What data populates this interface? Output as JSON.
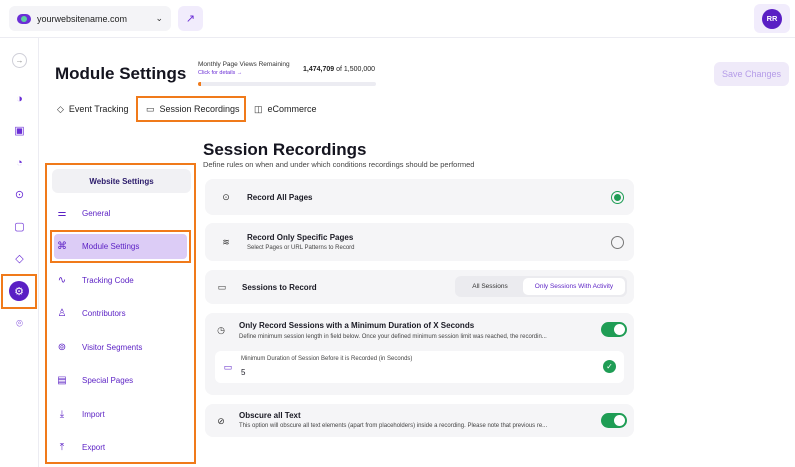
{
  "topbar": {
    "site": "yourwebsitename.com",
    "avatar_initials": "RR"
  },
  "header": {
    "title": "Module Settings",
    "pageviews_label": "Monthly Page Views Remaining",
    "pageviews_link": "Click for details →",
    "pageviews_used": "1,474,709",
    "pageviews_of": "of 1,500,000",
    "pageviews_fraction": 0.017,
    "save_label": "Save Changes"
  },
  "tabs": [
    {
      "label": "Event Tracking",
      "icon": "tag-icon"
    },
    {
      "label": "Session Recordings",
      "icon": "camera-icon"
    },
    {
      "label": "eCommerce",
      "icon": "bag-icon"
    }
  ],
  "sidebar": {
    "heading": "Website Settings",
    "items": [
      {
        "label": "General",
        "icon": "sliders-icon"
      },
      {
        "label": "Module Settings",
        "icon": "command-icon"
      },
      {
        "label": "Tracking Code",
        "icon": "pulse-icon"
      },
      {
        "label": "Contributors",
        "icon": "user-icon"
      },
      {
        "label": "Visitor Segments",
        "icon": "segments-icon"
      },
      {
        "label": "Special Pages",
        "icon": "pages-icon"
      },
      {
        "label": "Import",
        "icon": "import-icon"
      },
      {
        "label": "Export",
        "icon": "export-icon"
      }
    ]
  },
  "section": {
    "title": "Session Recordings",
    "subtitle": "Define rules on when and under which conditions recordings should be performed"
  },
  "options": {
    "record_all": {
      "title": "Record All Pages",
      "selected": true
    },
    "record_specific": {
      "title": "Record Only Specific Pages",
      "desc": "Select Pages or URL Patterns to Record",
      "selected": false
    },
    "sessions": {
      "title": "Sessions to Record",
      "seg_all": "All Sessions",
      "seg_activity": "Only Sessions With Activity"
    },
    "min_duration": {
      "title": "Only Record Sessions with a Minimum Duration of X Seconds",
      "desc": "Define minimum session length in field below. Once your defined minimum session limit was reached, the recordin...",
      "field_label": "Minimum Duration of Session Before it is Recorded (in Seconds)",
      "field_value": "5",
      "enabled": true
    },
    "obscure": {
      "title": "Obscure all Text",
      "desc": "This option will obscure all text elements (apart from placeholders) inside a recording. Please note that previous re...",
      "enabled": true
    }
  },
  "colors": {
    "accent": "#5a1fc4",
    "highlight": "#f07a1a",
    "success": "#1f9d55"
  }
}
